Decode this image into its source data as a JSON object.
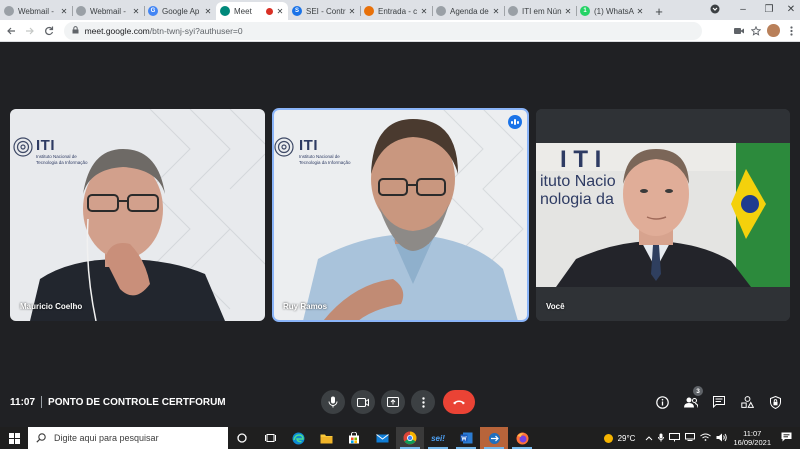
{
  "browser": {
    "tabs": [
      {
        "title": "Webmail -",
        "color": "#9aa0a6",
        "glyph": "",
        "active": false
      },
      {
        "title": "Webmail -",
        "color": "#9aa0a6",
        "glyph": "",
        "active": false
      },
      {
        "title": "Google Ap",
        "color": "#4285f4",
        "glyph": "G",
        "active": false
      },
      {
        "title": "Meet",
        "color": "#00897b",
        "glyph": "",
        "active": true,
        "recording": true
      },
      {
        "title": "SEI - Contr",
        "color": "#1a73e8",
        "glyph": "S",
        "active": false
      },
      {
        "title": "Entrada - c",
        "color": "#e8710a",
        "glyph": "",
        "active": false
      },
      {
        "title": "Agenda de",
        "color": "#9aa0a6",
        "glyph": "",
        "active": false
      },
      {
        "title": "ITI em Nún",
        "color": "#9aa0a6",
        "glyph": "",
        "active": false
      },
      {
        "title": "(1) WhatsA",
        "color": "#25d366",
        "glyph": "1",
        "active": false
      }
    ],
    "new_tab": "+",
    "window_controls": {
      "minimize": "–",
      "maximize": "❐",
      "close": "✕"
    },
    "url_host": "meet.google.com",
    "url_path": "/btn-twnj-syi?authuser=0"
  },
  "meeting": {
    "participants": [
      {
        "name": "Mauricio Coelho",
        "speaking": false
      },
      {
        "name": "Ruy Ramos",
        "speaking": true
      },
      {
        "name": "Você",
        "speaking": false
      }
    ],
    "logo_text": "ITI",
    "logo_subtitle_line1": "Instituto Nacional de",
    "logo_subtitle_line2": "Tecnologia da Informação",
    "wall_text_line1": "ituto Nacio",
    "wall_text_line2": "nologia da",
    "time": "11:07",
    "meeting_title": "PONTO DE CONTROLE CERTFORUM",
    "participant_count": "3"
  },
  "taskbar": {
    "search_placeholder": "Digite aqui para pesquisar",
    "weather": "29°C",
    "clock_time": "11:07",
    "clock_date": "16/09/2021",
    "sei_label": "sei!"
  }
}
